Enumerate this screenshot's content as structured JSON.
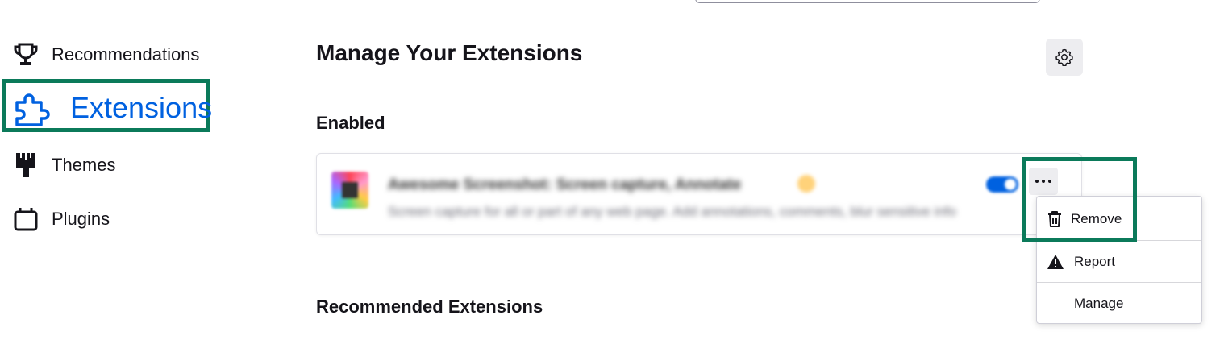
{
  "sidebar": {
    "items": [
      {
        "label": "Recommendations",
        "icon": "trophy-icon"
      },
      {
        "label": "Extensions",
        "icon": "puzzle-icon",
        "active": true
      },
      {
        "label": "Themes",
        "icon": "paintbrush-icon"
      },
      {
        "label": "Plugins",
        "icon": "plugin-icon"
      }
    ]
  },
  "main": {
    "title": "Manage Your Extensions",
    "enabled_heading": "Enabled",
    "recommended_heading": "Recommended Extensions",
    "extension": {
      "name": "Awesome Screenshot: Screen capture, Annotate",
      "description": "Screen capture for all or part of any web page. Add annotations, comments, blur sensitive info",
      "enabled": true
    }
  },
  "menu": {
    "items": [
      {
        "label": "Remove",
        "icon": "trash-icon"
      },
      {
        "label": "Report",
        "icon": "warning-icon"
      },
      {
        "label": "Manage"
      }
    ]
  },
  "colors": {
    "accent": "#0061e0",
    "highlight": "#0b7a5a"
  }
}
